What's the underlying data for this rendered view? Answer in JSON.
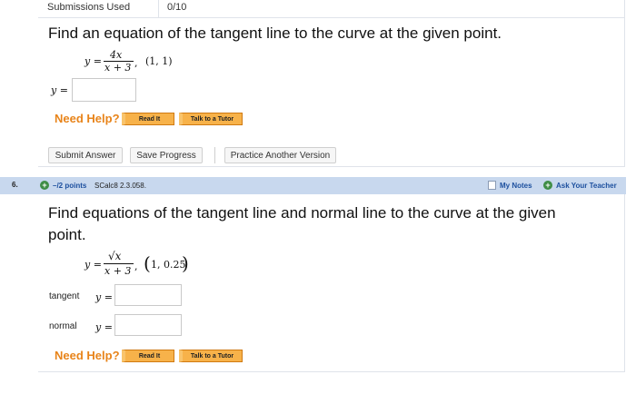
{
  "q5": {
    "submissions_label": "Submissions Used",
    "submissions_value": "0/10",
    "prompt": "Find an equation of the tangent line to the curve at the given point.",
    "eq_lhs": "y =",
    "eq_numerator": "4x",
    "eq_denominator": "x + 3",
    "eq_comma": ",",
    "point": "(1, 1)",
    "answer_label": "y =",
    "need_help": "Need Help?",
    "read_it": "Read It",
    "talk_to_tutor": "Talk to a Tutor",
    "submit_answer": "Submit Answer",
    "save_progress": "Save Progress",
    "practice_another": "Practice Another Version"
  },
  "q6": {
    "number": "6.",
    "points": "–/2 points",
    "code": "SCalc8 2.3.058.",
    "my_notes": "My Notes",
    "ask_teacher": "Ask Your Teacher",
    "prompt_line1": "Find equations of the tangent line and normal line to the curve at the given",
    "prompt_line2": "point.",
    "eq_lhs": "y =",
    "eq_numerator": "√x",
    "eq_denominator": "x + 3",
    "eq_comma": ",",
    "point_open": "(",
    "point_inner": "1, 0.25",
    "point_close": ")",
    "tangent_label": "tangent",
    "tangent_y": "y =",
    "normal_label": "normal",
    "normal_y": "y =",
    "need_help": "Need Help?",
    "read_it": "Read It",
    "talk_to_tutor": "Talk to a Tutor"
  },
  "colors": {
    "need_help": "#e8841a",
    "help_button": "#f7b24a",
    "header_bg": "#c8d8ee",
    "link_blue": "#1c4f9e",
    "plus_green": "#3f8d46"
  },
  "icons": {
    "plus": "+",
    "notes": "note-icon"
  }
}
